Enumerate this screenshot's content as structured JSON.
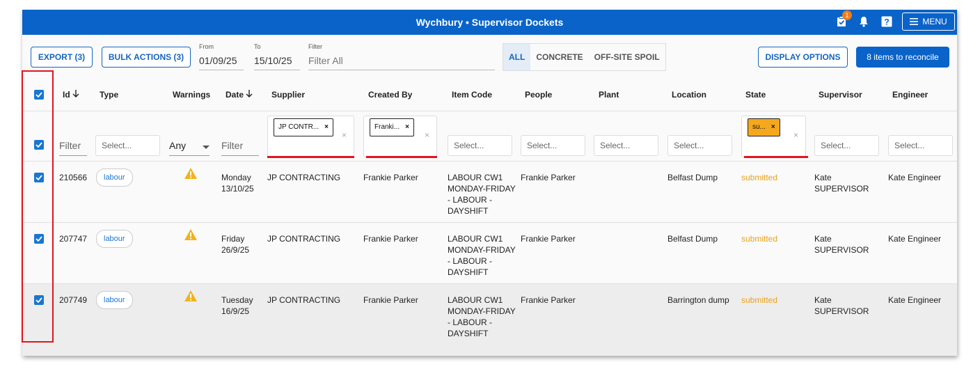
{
  "app": {
    "title": "Wychbury • Supervisor Dockets",
    "badge_count": "1",
    "menu_label": "MENU"
  },
  "toolbar": {
    "export_label": "EXPORT (3)",
    "bulk_label": "BULK ACTIONS (3)",
    "from_label": "From",
    "from_value": "01/09/25",
    "to_label": "To",
    "to_value": "15/10/25",
    "filter_label": "Filter",
    "filter_placeholder": "Filter All",
    "tabs": [
      "ALL",
      "CONCRETE",
      "OFF-SITE SPOIL"
    ],
    "display_options_label": "DISPLAY OPTIONS",
    "reconcile_label": "8 items to reconcile"
  },
  "columns": {
    "id": "Id",
    "type": "Type",
    "warnings": "Warnings",
    "date": "Date",
    "supplier": "Supplier",
    "created_by": "Created By",
    "item_code": "Item Code",
    "people": "People",
    "plant": "Plant",
    "location": "Location",
    "state": "State",
    "supervisor": "Supervisor",
    "engineer": "Engineer"
  },
  "filters": {
    "text_placeholder": "Filter",
    "select_placeholder": "Select...",
    "warnings_value": "Any",
    "supplier_chip": "JP CONTR...",
    "created_by_chip": "Franki...",
    "state_chip": "su...",
    "chip_remove": "×",
    "clear": "×"
  },
  "rows": [
    {
      "id": "210566",
      "type": "labour",
      "date_day": "Monday",
      "date": "13/10/25",
      "supplier": "JP CONTRACTING",
      "created_by": "Frankie Parker",
      "item_code": [
        "LABOUR CW1",
        "MONDAY-FRIDAY",
        "- LABOUR -",
        "DAYSHIFT"
      ],
      "people": "Frankie Parker",
      "plant": "",
      "location": "Belfast Dump",
      "state": "submitted",
      "supervisor": [
        "Kate",
        "SUPERVISOR"
      ],
      "engineer": "Kate Engineer"
    },
    {
      "id": "207747",
      "type": "labour",
      "date_day": "Friday",
      "date": "26/9/25",
      "supplier": "JP CONTRACTING",
      "created_by": "Frankie Parker",
      "item_code": [
        "LABOUR CW1",
        "MONDAY-FRIDAY",
        "- LABOUR -",
        "DAYSHIFT"
      ],
      "people": "Frankie Parker",
      "plant": "",
      "location": "Belfast Dump",
      "state": "submitted",
      "supervisor": [
        "Kate",
        "SUPERVISOR"
      ],
      "engineer": "Kate Engineer"
    },
    {
      "id": "207749",
      "type": "labour",
      "date_day": "Tuesday",
      "date": "16/9/25",
      "supplier": "JP CONTRACTING",
      "created_by": "Frankie Parker",
      "item_code": [
        "LABOUR CW1",
        "MONDAY-FRIDAY",
        "- LABOUR -",
        "DAYSHIFT"
      ],
      "people": "Frankie Parker",
      "plant": "",
      "location": "Barrington dump",
      "state": "submitted",
      "supervisor": [
        "Kate",
        "SUPERVISOR"
      ],
      "engineer": "Kate Engineer"
    }
  ],
  "colors": {
    "primary": "#0a63c8",
    "state": "#e9a21e",
    "highlight": "#e0151f",
    "chip_state": "#f5a81c"
  },
  "icons": {
    "tasks": "clipboard-check-icon",
    "bell": "bell-icon",
    "help": "help-icon",
    "menu": "hamburger-icon",
    "warning": "warning-icon",
    "sort": "arrow-down-icon"
  }
}
